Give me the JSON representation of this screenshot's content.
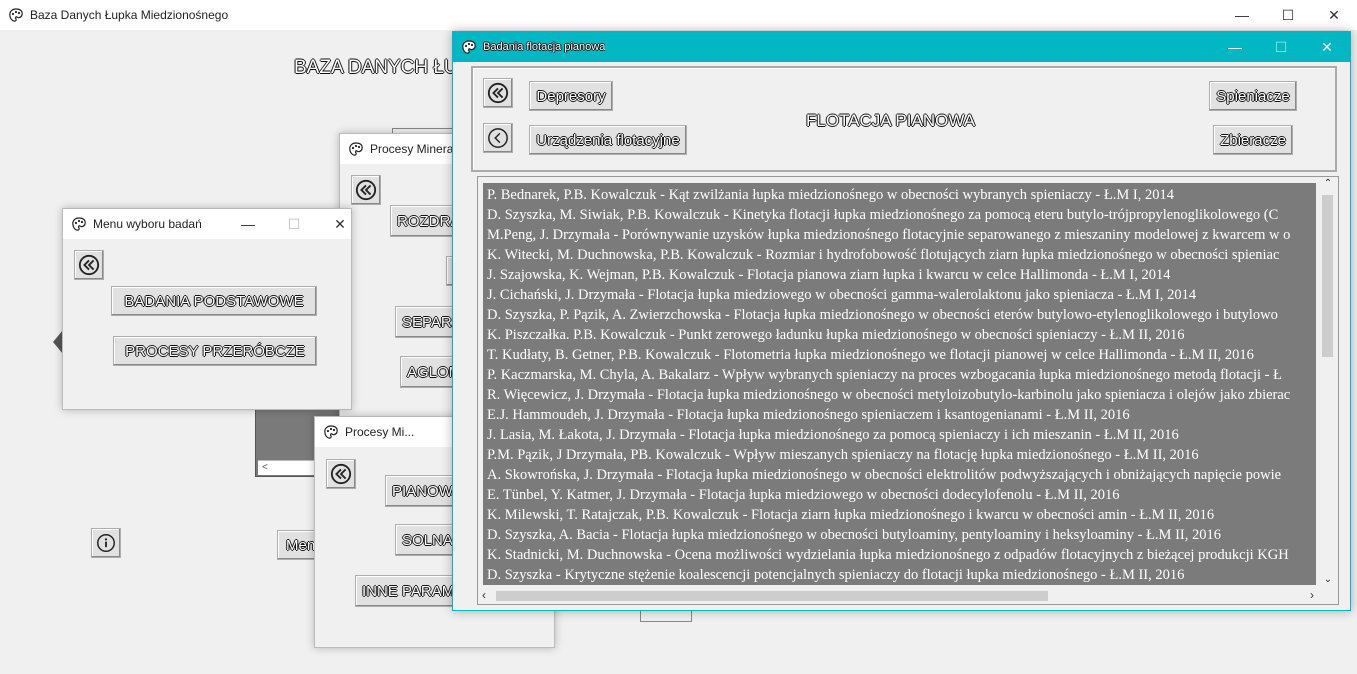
{
  "main": {
    "title": "Baza Danych Łupka Miedzionośnego",
    "heading": "BAZA DANYCH ŁUPKA MIEDZIONOŚNEGO",
    "bottom_button": "Menu"
  },
  "menu_window": {
    "title": "Menu wyboru badań",
    "btn_podstawowe": "BADANIA PODSTAWOWE",
    "btn_przerobcze": "PROCESY PRZERÓBCZE"
  },
  "procesy_window": {
    "title": "Procesy Mineralne",
    "btn1": "ROZDRABNIANIE",
    "btn2": "SEPARACJA",
    "btn3": "AGLOMERACJA"
  },
  "procesy2_window": {
    "title": "Procesy Mi...",
    "btn1": "PIANOWA",
    "btn2": "SOLNA",
    "btn3": "INNE PARAMETRY"
  },
  "flotacja_window": {
    "title": "Badania flotacja pianowa",
    "heading": "FLOTACJA PIANOWA",
    "btn_depresory": "Depresory",
    "btn_urzadzenia": "Urządzenia flotacyjne",
    "btn_spieniacze": "Spieniacze",
    "btn_zbieracze": "Zbieracze",
    "items": [
      "P. Bednarek, P.B. Kowalczuk - Kąt zwilżania łupka miedzionośnego w obecności wybranych spieniaczy - Ł.M I, 2014",
      "D. Szyszka, M. Siwiak, P.B. Kowalczuk - Kinetyka flotacji łupka miedzionośnego za pomocą eteru butylo-trójpropylenoglikolowego (C",
      "M.Peng, J. Drzymała - Porównywanie uzysków łupka miedzionośnego flotacyjnie separowanego z mieszaniny modelowej z kwarcem w o",
      "K. Witecki, M. Duchnowska, P.B. Kowalczuk - Rozmiar i hydrofobowość flotujących ziarn łupka miedzionośnego w obecności spieniac",
      "J. Szajowska, K. Wejman, P.B. Kowalczuk - Flotacja pianowa ziarn łupka i kwarcu w celce Hallimonda  - Ł.M I, 2014",
      "J. Cichański, J. Drzymała - Flotacja łupka miedziowego w obecności gamma-walerolaktonu jako spieniacza  - Ł.M I, 2014",
      "D. Szyszka, P. Pązik, A. Zwierzchowska - Flotacja łupka miedzionośnego w obecności eterów butylowo-etylenoglikolowego i butylowo",
      "K. Piszczałka. P.B. Kowalczuk - Punkt zerowego ładunku łupka miedzionośnego w obecności spieniaczy - Ł.M II, 2016",
      "T. Kudłaty, B. Getner, P.B. Kowalczuk - Flotometria łupka miedzionośnego we flotacji pianowej w celce Hallimonda - Ł.M II, 2016",
      "P. Kaczmarska, M. Chyla, A. Bakalarz - Wpływ wybranych spieniaczy na proces wzbogacania łupka miedzionośnego metodą flotacji - Ł",
      "R. Więcewicz, J. Drzymała - Flotacja łupka miedzionośnego w obecności metyloizobutylo-karbinolu jako spieniacza i olejów jako zbierac",
      "E.J. Hammoudeh, J. Drzymała - Flotacja łupka miedzionośnego spieniaczem i ksantogenianami - Ł.M II, 2016",
      "J. Lasia, M. Łakota, J. Drzymała - Flotacja łupka miedzionośnego za pomocą spieniaczy i ich mieszanin - Ł.M II, 2016",
      "P.M. Pązik, J Drzymała, PB. Kowalczuk - Wpływ mieszanych spieniaczy na flotację łupka miedzionośnego - Ł.M II, 2016",
      "A. Skowrońska, J. Drzymała - Flotacja łupka miedzionośnego w obecności elektrolitów podwyższających i obniżających napięcie powie",
      "E. Tünbel, Y. Katmer, J. Drzymała - Flotacja łupka miedziowego w obecności dodecylofenolu - Ł.M II, 2016",
      "K. Milewski, T. Ratajczak, P.B. Kowalczuk - Flotacja ziarn łupka miedzionośnego i kwarcu w obecności amin - Ł.M II, 2016",
      "D. Szyszka, A. Bacia - Flotacja łupka miedzionośnego w obecności butyloaminy, pentyloaminy i heksyloaminy - Ł.M II, 2016",
      "K. Stadnicki, M. Duchnowska - Ocena możliwości wydzielania łupka miedzionośnego z odpadów flotacyjnych z bieżącej produkcji KGH",
      "D. Szyszka - Krytyczne stężenie koalescencji potencjalnych spieniaczy do flotacji łupka miedzionośnego - Ł.M II, 2016"
    ]
  }
}
